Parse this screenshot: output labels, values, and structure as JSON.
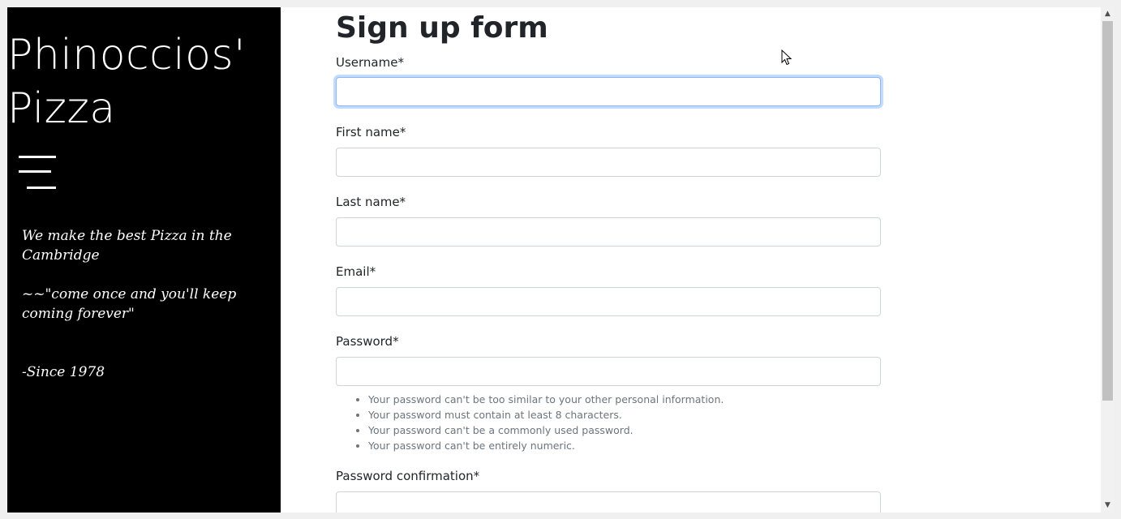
{
  "sidebar": {
    "brand_line1": "Phinoccios'",
    "brand_line2": "Pizza",
    "menu_icon": "hamburger-menu-icon",
    "tagline1": "We make the best Pizza in the Cambridge",
    "tagline2": "~~\"come once and you'll keep coming forever\"",
    "tagline3": "-Since 1978"
  },
  "form": {
    "title": "Sign up form",
    "fields": [
      {
        "label": "Username*",
        "value": ""
      },
      {
        "label": "First name*",
        "value": ""
      },
      {
        "label": "Last name*",
        "value": ""
      },
      {
        "label": "Email*",
        "value": ""
      },
      {
        "label": "Password*",
        "value": ""
      },
      {
        "label": "Password confirmation*",
        "value": ""
      }
    ],
    "password_help": [
      "Your password can't be too similar to your other personal information.",
      "Your password must contain at least 8 characters.",
      "Your password can't be a commonly used password.",
      "Your password can't be entirely numeric."
    ]
  },
  "colors": {
    "sidebar_bg": "#000000",
    "focus_border": "#86b7fe",
    "text": "#212529",
    "help_text": "#6c757d"
  }
}
